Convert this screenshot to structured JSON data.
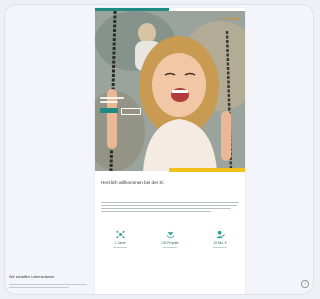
{
  "colors": {
    "accent": "#1f8a84",
    "highlight": "#f2c21b",
    "brand": "#e08a14"
  },
  "hero": {
    "logo_text": "STIFTUNG"
  },
  "content": {
    "title": "Herzlich willkommen bei der Ki"
  },
  "stats": [
    {
      "value": "1. Jahre",
      "icon": "network-icon"
    },
    {
      "value": "100 Projekte",
      "icon": "hands-heart-icon"
    },
    {
      "value": "15 Mio. €",
      "icon": "person-check-icon"
    }
  ],
  "footer": {
    "section_title": "Wir schaffen Lebensräume"
  },
  "help": {
    "symbol": "?"
  }
}
